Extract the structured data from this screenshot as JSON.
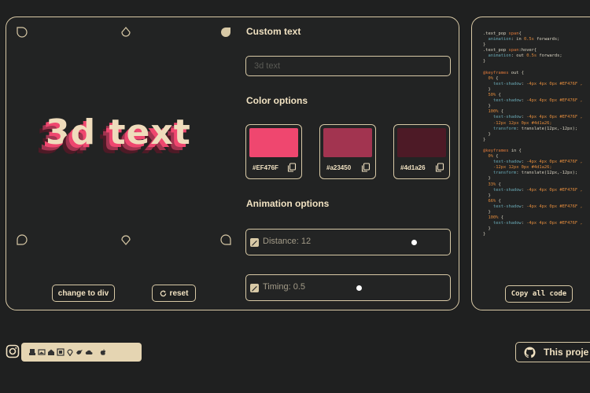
{
  "preview": {
    "first_char": "3",
    "rest_text": "d text"
  },
  "buttons": {
    "change_label": "change to div",
    "reset_label": "reset",
    "copy_code_label": "Copy all code",
    "project_label": "This proje"
  },
  "sections": {
    "custom_text": "Custom text",
    "color_options": "Color options",
    "animation_options": "Animation options"
  },
  "input": {
    "placeholder": "3d text",
    "value": ""
  },
  "colors": [
    {
      "hex": "#EF476F",
      "label": "#EF476F"
    },
    {
      "hex": "#a23450",
      "label": "#a23450"
    },
    {
      "hex": "#4d1a26",
      "label": "#4d1a26"
    }
  ],
  "sliders": {
    "distance_label": "Distance: 12",
    "distance_fraction": 0.81,
    "timing_label": "Timing: 0.5",
    "timing_fraction": 0.44
  },
  "code_lines": [
    [
      [
        "c-sel",
        ".text_pop "
      ],
      [
        "c-kw",
        "span"
      ],
      [
        "c-sel",
        "{"
      ]
    ],
    [
      [
        "c-prop",
        "  animation"
      ],
      [
        "c-sel",
        ": in "
      ],
      [
        "c-val",
        "0.5s"
      ],
      [
        "c-sel",
        " forwards;"
      ]
    ],
    [
      [
        "c-sel",
        "}"
      ]
    ],
    [
      [
        "c-sel",
        ".text_pop "
      ],
      [
        "c-kw",
        "span"
      ],
      [
        "c-sel",
        ":hover{"
      ]
    ],
    [
      [
        "c-prop",
        "  animation"
      ],
      [
        "c-sel",
        ": out "
      ],
      [
        "c-val",
        "0.5s"
      ],
      [
        "c-sel",
        " forwards;"
      ]
    ],
    [
      [
        "c-sel",
        "}"
      ]
    ],
    [
      [
        "c-sel",
        ""
      ]
    ],
    [
      [
        "c-kw",
        "@keyframes"
      ],
      [
        "c-sel",
        " out {"
      ]
    ],
    [
      [
        "c-val",
        "  0%"
      ],
      [
        "c-sel",
        " {"
      ]
    ],
    [
      [
        "c-prop",
        "    text-shadow"
      ],
      [
        "c-sel",
        ": "
      ],
      [
        "c-val",
        "-4px 4px 0px #EF476F ,"
      ]
    ],
    [
      [
        "c-sel",
        "  }"
      ]
    ],
    [
      [
        "c-val",
        "  50%"
      ],
      [
        "c-sel",
        " {"
      ]
    ],
    [
      [
        "c-prop",
        "    text-shadow"
      ],
      [
        "c-sel",
        ": "
      ],
      [
        "c-val",
        "-4px 4px 0px #EF476F ,"
      ]
    ],
    [
      [
        "c-sel",
        "  }"
      ]
    ],
    [
      [
        "c-val",
        "  100%"
      ],
      [
        "c-sel",
        " {"
      ]
    ],
    [
      [
        "c-prop",
        "    text-shadow"
      ],
      [
        "c-sel",
        ": "
      ],
      [
        "c-val",
        "-4px 4px 0px #EF476F ,"
      ]
    ],
    [
      [
        "c-val",
        "    -12px 12px 0px #4d1a26;"
      ]
    ],
    [
      [
        "c-prop",
        "    transform"
      ],
      [
        "c-sel",
        ": translate(12px,-12px);"
      ]
    ],
    [
      [
        "c-sel",
        "  }"
      ]
    ],
    [
      [
        "c-sel",
        "}"
      ]
    ],
    [
      [
        "c-sel",
        ""
      ]
    ],
    [
      [
        "c-kw",
        "@keyframes"
      ],
      [
        "c-sel",
        " in {"
      ]
    ],
    [
      [
        "c-val",
        "  0%"
      ],
      [
        "c-sel",
        " {"
      ]
    ],
    [
      [
        "c-prop",
        "    text-shadow"
      ],
      [
        "c-sel",
        ": "
      ],
      [
        "c-val",
        "-4px 4px 0px #EF476F ,"
      ]
    ],
    [
      [
        "c-val",
        "    -12px 12px 0px #4d1a26;"
      ]
    ],
    [
      [
        "c-prop",
        "    transform"
      ],
      [
        "c-sel",
        ": translate(12px,-12px);"
      ]
    ],
    [
      [
        "c-sel",
        "  }"
      ]
    ],
    [
      [
        "c-val",
        "  33%"
      ],
      [
        "c-sel",
        " {"
      ]
    ],
    [
      [
        "c-prop",
        "    text-shadow"
      ],
      [
        "c-sel",
        ": "
      ],
      [
        "c-val",
        "-4px 4px 0px #EF476F ,"
      ]
    ],
    [
      [
        "c-sel",
        "  }"
      ]
    ],
    [
      [
        "c-val",
        "  66%"
      ],
      [
        "c-sel",
        " {"
      ]
    ],
    [
      [
        "c-prop",
        "    text-shadow"
      ],
      [
        "c-sel",
        ": "
      ],
      [
        "c-val",
        "-4px 4px 0px #EF476F ,"
      ]
    ],
    [
      [
        "c-sel",
        "  }"
      ]
    ],
    [
      [
        "c-val",
        "  100%"
      ],
      [
        "c-sel",
        " {"
      ]
    ],
    [
      [
        "c-prop",
        "    text-shadow"
      ],
      [
        "c-sel",
        ": "
      ],
      [
        "c-val",
        "-4px 4px 0px #EF476F ,"
      ]
    ],
    [
      [
        "c-sel",
        "  }"
      ]
    ],
    [
      [
        "c-sel",
        "}"
      ]
    ]
  ],
  "icons": {
    "deco": "drop-shape-icon",
    "copy": "copy-icon",
    "reset": "refresh-icon",
    "check": "pencil-check-icon",
    "instagram": "instagram-icon",
    "github": "github-icon"
  },
  "theme": {
    "background": "#1f2020",
    "border": "#d8c9a6",
    "text": "#f1e2c2"
  }
}
